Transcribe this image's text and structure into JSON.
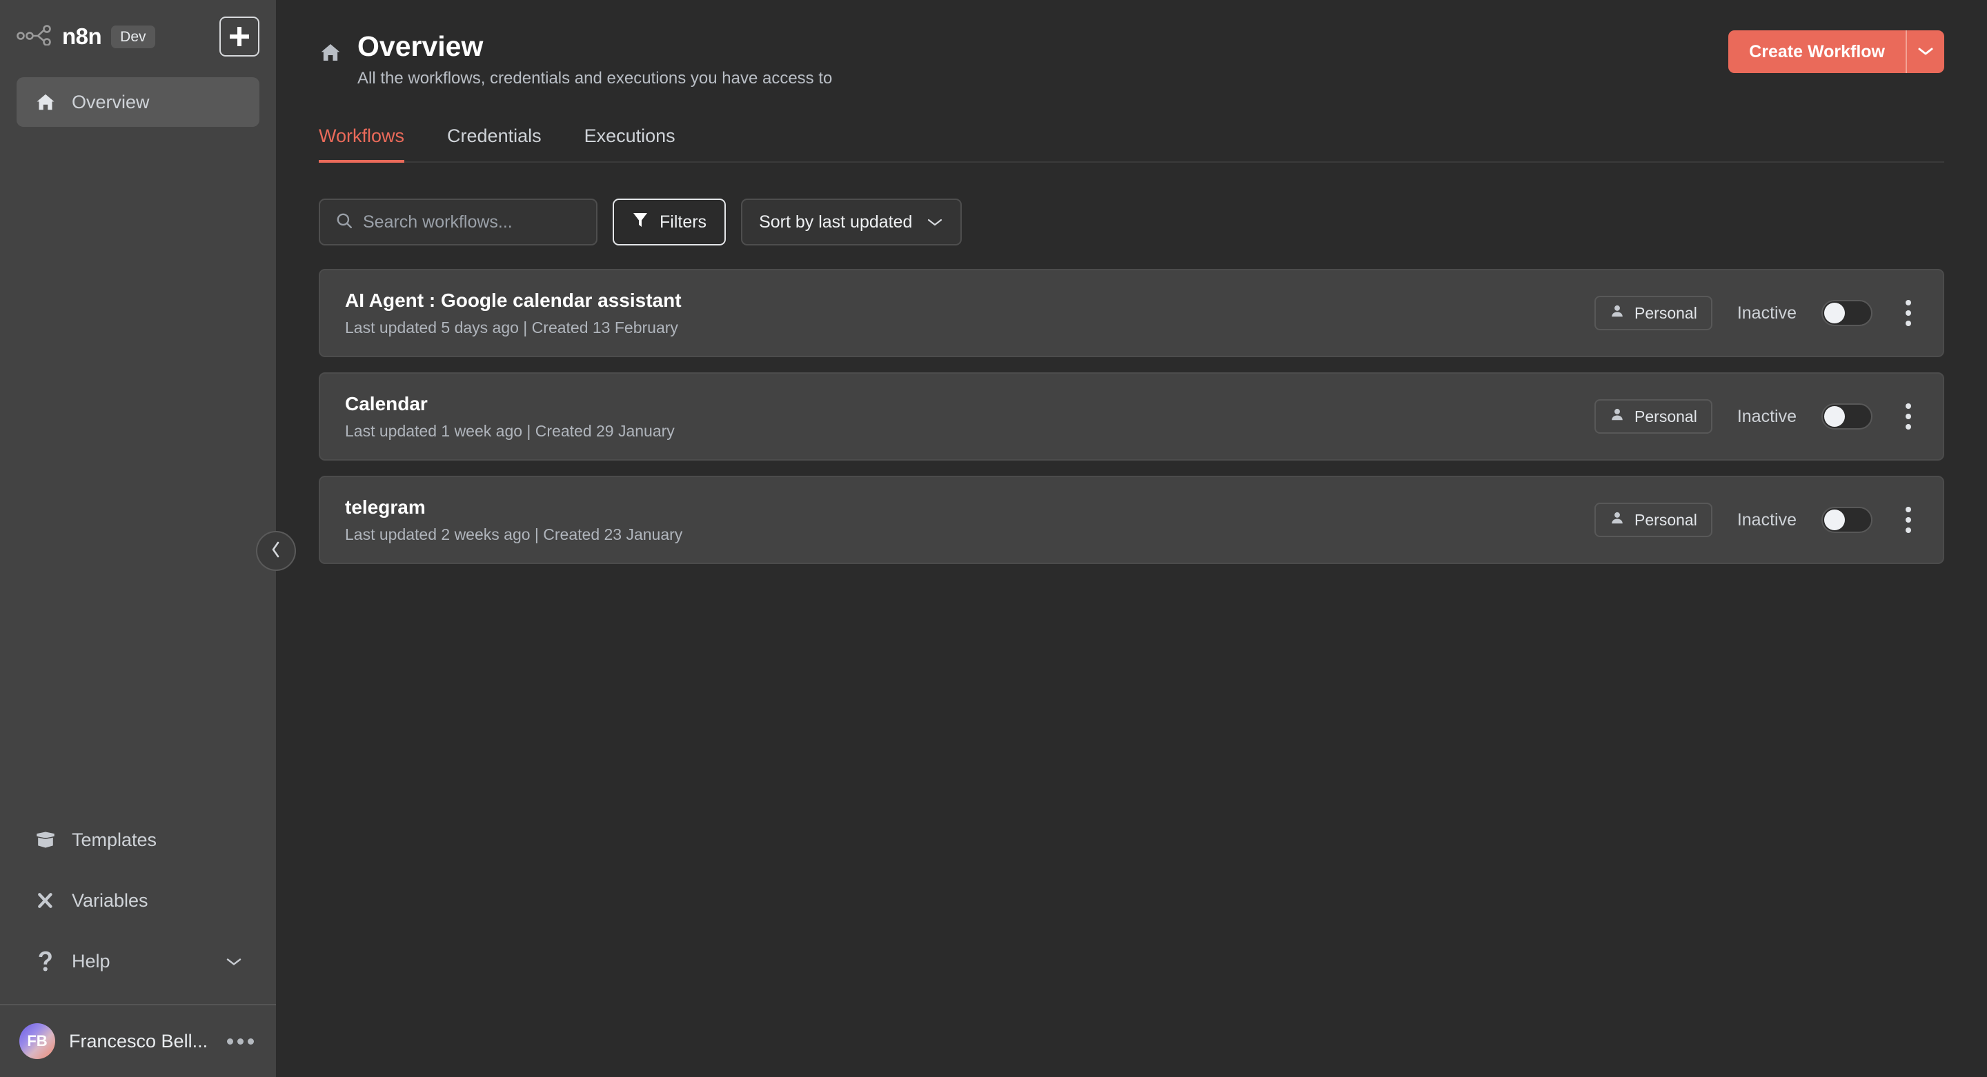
{
  "sidebar": {
    "brand": {
      "name": "n8n",
      "badge": "Dev",
      "logo_icon": "n8n-logo-icon"
    },
    "add_button": {
      "icon": "plus-icon"
    },
    "primary_items": [
      {
        "label": "Overview",
        "icon": "home-icon",
        "active": true
      }
    ],
    "secondary_items": [
      {
        "label": "Templates",
        "icon": "box-icon"
      },
      {
        "label": "Variables",
        "icon": "variables-x-icon"
      },
      {
        "label": "Help",
        "icon": "question-mark-icon",
        "chevron": "chevron-down-icon"
      }
    ],
    "user": {
      "initials": "FB",
      "name": "Francesco Bell...",
      "menu_icon": "more-horizontal-icon"
    },
    "collapse": {
      "icon": "chevron-left-icon"
    }
  },
  "header": {
    "icon": "home-icon",
    "title": "Overview",
    "subtitle": "All the workflows, credentials and executions you have access to",
    "create_label": "Create Workflow",
    "create_caret_icon": "chevron-down-icon",
    "accent_color": "#ea6a5a"
  },
  "tabs": [
    {
      "label": "Workflows",
      "active": true
    },
    {
      "label": "Credentials",
      "active": false
    },
    {
      "label": "Executions",
      "active": false
    }
  ],
  "toolbar": {
    "search": {
      "placeholder": "Search workflows...",
      "value": "",
      "icon": "search-icon"
    },
    "filters": {
      "label": "Filters",
      "icon": "funnel-icon"
    },
    "sort": {
      "label": "Sort by last updated",
      "icon": "chevron-down-icon"
    }
  },
  "workflows": [
    {
      "name": "AI Agent : Google calendar assistant",
      "meta": "Last updated 5 days ago | Created 13 February",
      "owner": "Personal",
      "state": "Inactive",
      "active": false
    },
    {
      "name": "Calendar",
      "meta": "Last updated 1 week ago | Created 29 January",
      "owner": "Personal",
      "state": "Inactive",
      "active": false
    },
    {
      "name": "telegram",
      "meta": "Last updated 2 weeks ago | Created 23 January",
      "owner": "Personal",
      "state": "Inactive",
      "active": false
    }
  ],
  "colors": {
    "sidebar_bg": "#434343",
    "main_bg": "#2b2b2b",
    "card_bg": "#434343",
    "accent": "#ea6a5a"
  }
}
